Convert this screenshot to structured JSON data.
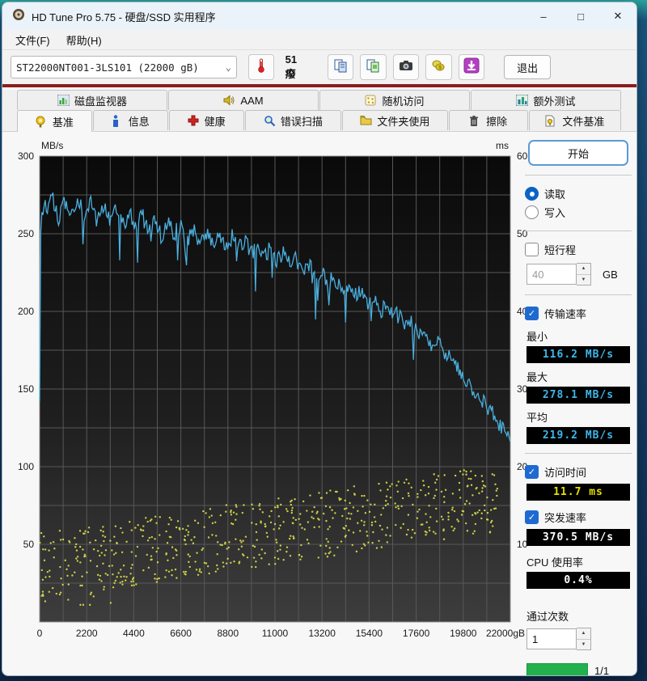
{
  "window": {
    "title": "HD Tune Pro 5.75 - 硬盘/SSD 实用程序",
    "minimize": "–",
    "maximize": "□",
    "close": "✕"
  },
  "menu": {
    "file": "文件(F)",
    "help": "帮助(H)"
  },
  "toolbar": {
    "drive": "ST22000NT001-3LS101 (22000 gB)",
    "chevron": "⌄",
    "temperature": "51癈",
    "exit": "退出"
  },
  "tabs": {
    "row1": [
      {
        "label": "磁盘监视器"
      },
      {
        "label": "AAM"
      },
      {
        "label": "随机访问"
      },
      {
        "label": "额外测试"
      }
    ],
    "row2": [
      {
        "label": "基准"
      },
      {
        "label": "信息"
      },
      {
        "label": "健康"
      },
      {
        "label": "错误扫描"
      },
      {
        "label": "文件夹使用"
      },
      {
        "label": "擦除"
      },
      {
        "label": "文件基准"
      }
    ]
  },
  "sidebar": {
    "start": "开始",
    "read": "读取",
    "write": "写入",
    "short_stroke": "短行程",
    "short_stroke_value": "40",
    "gb": "GB",
    "transfer_rate": "传输速率",
    "min_label": "最小",
    "min_value": "116.2 MB/s",
    "max_label": "最大",
    "max_value": "278.1 MB/s",
    "avg_label": "平均",
    "avg_value": "219.2 MB/s",
    "access_time": "访问时间",
    "access_time_value": "11.7 ms",
    "burst_rate": "突发速率",
    "burst_rate_value": "370.5 MB/s",
    "cpu_label": "CPU 使用率",
    "cpu_value": "0.4%",
    "pass_count_label": "通过次数",
    "pass_count_value": "1",
    "progress_text": "1/1"
  },
  "colors": {
    "read_line": "#4aafdf",
    "access_dots": "#d6d84a",
    "lcd_cyan": "#3db7ea",
    "lcd_yellow": "#e3e000",
    "progress_green": "#22b14c",
    "accent_red_line": "#8b1d1d",
    "start_border_blue": "#5b9bd5"
  },
  "chart_data": {
    "type": "line",
    "title": "HD Tune Pro read benchmark: transfer rate (MB/s) and access time scatter (ms) vs disk position (gB)",
    "x_axis": {
      "unit": "gB",
      "min": 0,
      "max": 22000,
      "grid_step": 1100,
      "ticks": [
        0,
        2200,
        4400,
        6600,
        8800,
        11000,
        13200,
        15400,
        17600,
        19800,
        22000
      ],
      "last_tick_suffix": "gB"
    },
    "y_left": {
      "label": "MB/s",
      "min": 0,
      "max": 300,
      "grid_step": 25,
      "ticks": [
        300,
        250,
        200,
        150,
        100,
        50
      ]
    },
    "y_right": {
      "label": "ms",
      "min": 0,
      "max": 60,
      "ticks": [
        60,
        50,
        40,
        30,
        20,
        10
      ]
    },
    "series": [
      {
        "name": "transfer_rate_read",
        "unit": "MB/s",
        "min": 116.2,
        "max": 278.1,
        "avg": 219.2,
        "anchors": [
          [
            0,
            142
          ],
          [
            60,
            268
          ],
          [
            300,
            266
          ],
          [
            600,
            272
          ],
          [
            900,
            260
          ],
          [
            1200,
            271
          ],
          [
            1500,
            263
          ],
          [
            1800,
            274
          ],
          [
            2100,
            262
          ],
          [
            2400,
            270
          ],
          [
            2700,
            258
          ],
          [
            3000,
            269
          ],
          [
            3300,
            259
          ],
          [
            3600,
            268
          ],
          [
            3900,
            256
          ],
          [
            4200,
            264
          ],
          [
            4500,
            254
          ],
          [
            4800,
            262
          ],
          [
            5100,
            250
          ],
          [
            5400,
            260
          ],
          [
            5700,
            248
          ],
          [
            6000,
            256
          ],
          [
            6300,
            250
          ],
          [
            6600,
            255
          ],
          [
            6900,
            246
          ],
          [
            7200,
            252
          ],
          [
            7500,
            244
          ],
          [
            7800,
            250
          ],
          [
            8100,
            243
          ],
          [
            8400,
            251
          ],
          [
            8700,
            241
          ],
          [
            9000,
            248
          ],
          [
            9300,
            240
          ],
          [
            9600,
            246
          ],
          [
            9900,
            237
          ],
          [
            10200,
            243
          ],
          [
            10500,
            235
          ],
          [
            10800,
            241
          ],
          [
            11100,
            233
          ],
          [
            11400,
            238
          ],
          [
            11700,
            230
          ],
          [
            12000,
            234
          ],
          [
            12300,
            226
          ],
          [
            12600,
            230
          ],
          [
            12900,
            222
          ],
          [
            13200,
            226
          ],
          [
            13500,
            218
          ],
          [
            13800,
            222
          ],
          [
            14100,
            214
          ],
          [
            14400,
            217
          ],
          [
            14700,
            209
          ],
          [
            15000,
            213
          ],
          [
            15300,
            205
          ],
          [
            15600,
            208
          ],
          [
            15900,
            200
          ],
          [
            16200,
            203
          ],
          [
            16500,
            196
          ],
          [
            16800,
            198
          ],
          [
            17100,
            191
          ],
          [
            17400,
            193
          ],
          [
            17700,
            185
          ],
          [
            18000,
            187
          ],
          [
            18300,
            179
          ],
          [
            18600,
            181
          ],
          [
            18900,
            174
          ],
          [
            19200,
            170
          ],
          [
            19500,
            163
          ],
          [
            19800,
            158
          ],
          [
            20100,
            152
          ],
          [
            20400,
            148
          ],
          [
            20700,
            142
          ],
          [
            21000,
            137
          ],
          [
            21300,
            132
          ],
          [
            21600,
            126
          ],
          [
            21800,
            122
          ],
          [
            22000,
            118
          ]
        ]
      },
      {
        "name": "access_time_scatter",
        "unit": "ms",
        "avg": 11.7,
        "count": 640,
        "trend": [
          [
            0,
            7.2
          ],
          [
            22000,
            16.2
          ]
        ],
        "spread": 4.3,
        "clamp": [
          2.2,
          19.8
        ]
      }
    ],
    "noise": {
      "amp": 11,
      "dip_prob": 0.05,
      "dip_min": 8,
      "dip_max": 26,
      "seed": 11
    },
    "legend_position": "none",
    "grid": true,
    "plot_bg": "black"
  }
}
